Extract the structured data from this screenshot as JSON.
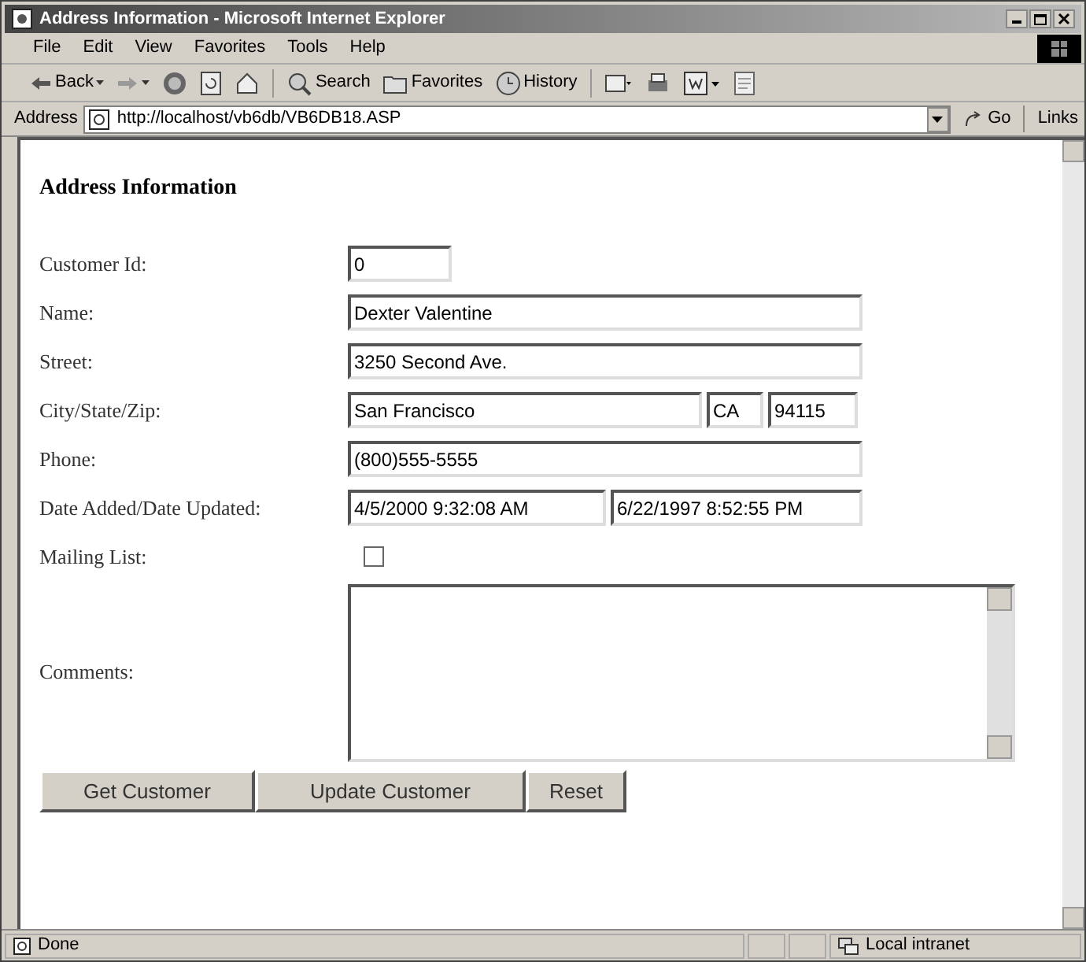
{
  "window": {
    "title": "Address Information - Microsoft Internet Explorer"
  },
  "menu": [
    "File",
    "Edit",
    "View",
    "Favorites",
    "Tools",
    "Help"
  ],
  "toolbar": [
    {
      "kind": "back",
      "label": "Back"
    },
    {
      "kind": "forward"
    },
    {
      "kind": "stop"
    },
    {
      "kind": "refresh"
    },
    {
      "kind": "home"
    },
    {
      "kind": "search",
      "label": "Search"
    },
    {
      "kind": "favorites",
      "label": "Favorites"
    },
    {
      "kind": "history",
      "label": "History"
    },
    {
      "kind": "mail"
    },
    {
      "kind": "print"
    },
    {
      "kind": "edit"
    },
    {
      "kind": "discuss"
    }
  ],
  "address_bar": {
    "label": "Address",
    "url": "http://localhost/vb6db/VB6DB18.ASP",
    "go": "Go",
    "links": "Links"
  },
  "form": {
    "heading": "Address Information",
    "rows": [
      {
        "kind": "fields",
        "label": "Customer Id:",
        "fields": [
          "0"
        ]
      },
      {
        "kind": "fields",
        "label": "Name:",
        "fields": [
          "Dexter Valentine"
        ]
      },
      {
        "kind": "fields",
        "label": "Street:",
        "fields": [
          "3250 Second Ave."
        ]
      },
      {
        "kind": "fields",
        "label": "City/State/Zip:",
        "fields": [
          "San Francisco",
          "CA",
          "94115"
        ]
      },
      {
        "kind": "fields",
        "label": "Phone:",
        "fields": [
          "(800)555-5555"
        ]
      },
      {
        "kind": "fields",
        "label": "Date Added/Date Updated:",
        "fields": [
          "4/5/2000 9:32:08 AM",
          "6/22/1997 8:52:55 PM"
        ]
      },
      {
        "kind": "checkbox",
        "label": "Mailing List:",
        "checked": false
      },
      {
        "kind": "textarea",
        "label": "Comments:"
      }
    ],
    "buttons": [
      "Get Customer",
      "Update Customer",
      "Reset"
    ]
  },
  "status_bar": {
    "text": "Done",
    "zone": "Local intranet"
  }
}
